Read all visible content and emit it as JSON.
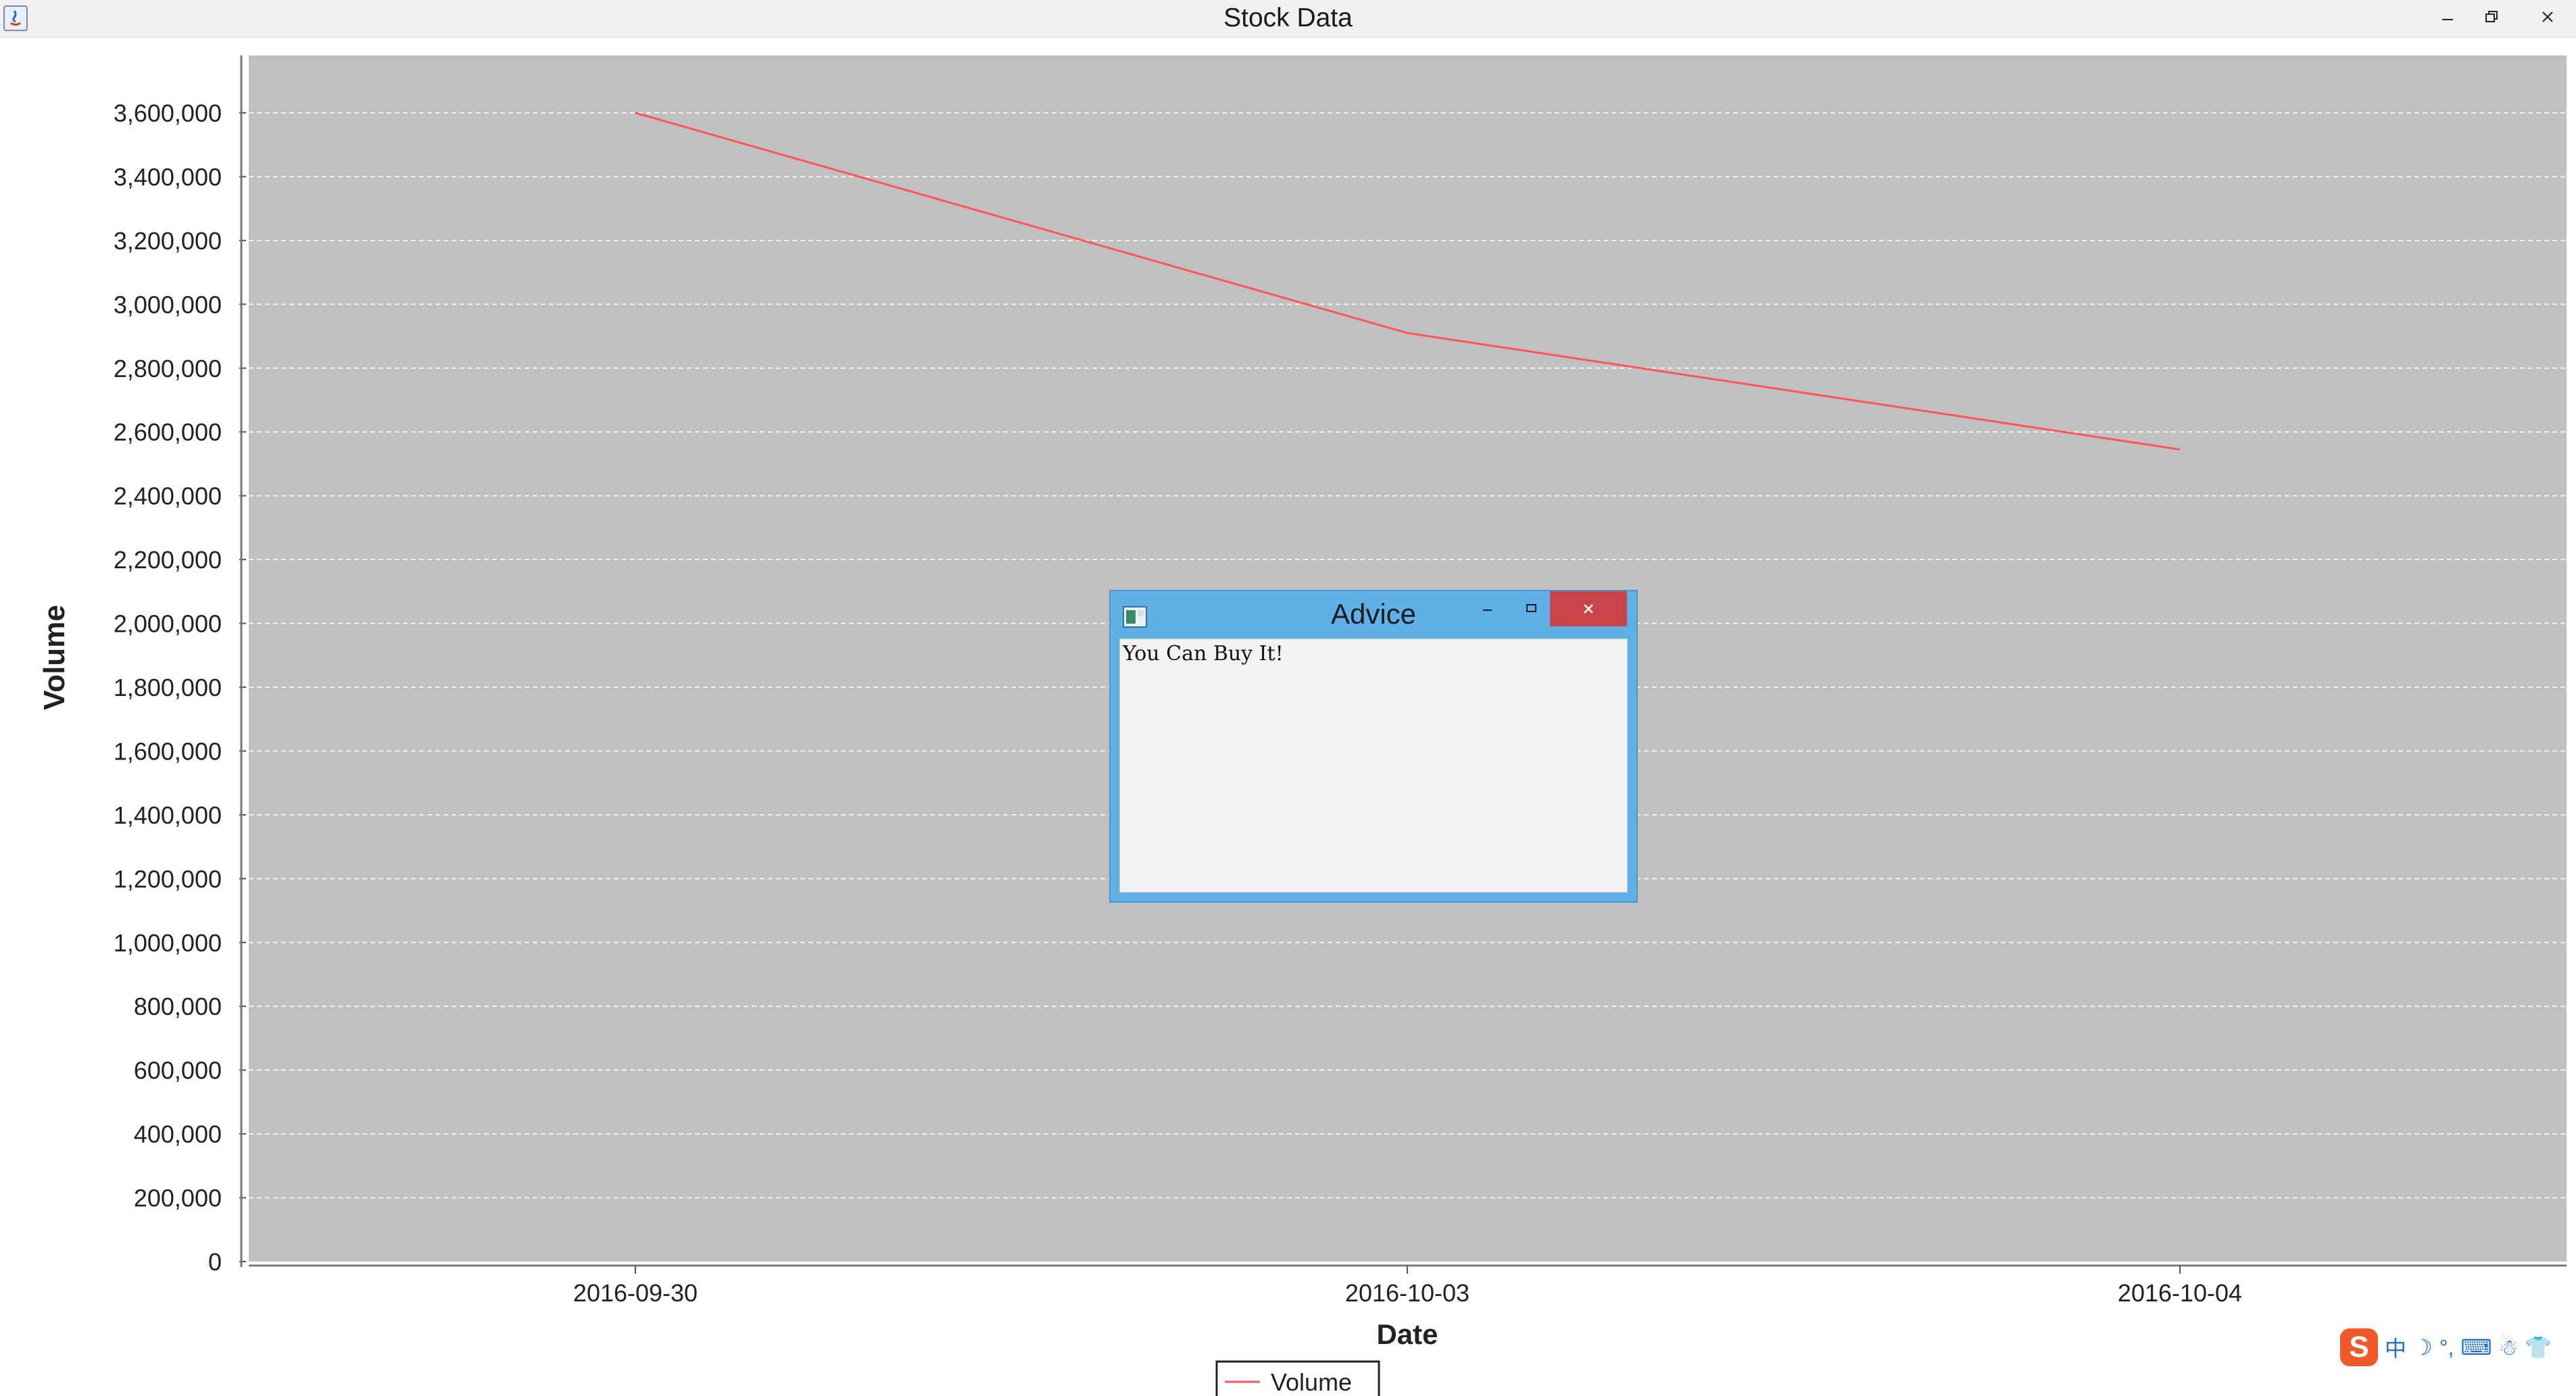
{
  "window": {
    "title": "Stock Data"
  },
  "dialog": {
    "title": "Advice",
    "message": "You Can Buy It!"
  },
  "ime": {
    "logo": "S",
    "glyphs": [
      "中",
      "☽",
      "°,",
      "⌨",
      "☃",
      "👕",
      "✓"
    ]
  },
  "chart_data": {
    "type": "line",
    "title": "",
    "xlabel": "Date",
    "ylabel": "Volume",
    "categories": [
      "2016-09-30",
      "2016-10-03",
      "2016-10-04"
    ],
    "series": [
      {
        "name": "Volume",
        "values": [
          3600000,
          2910000,
          2545000
        ],
        "color": "#ff5555"
      }
    ],
    "ylim": [
      0,
      3780000
    ],
    "yticks": [
      0,
      200000,
      400000,
      600000,
      800000,
      1000000,
      1200000,
      1400000,
      1600000,
      1800000,
      2000000,
      2200000,
      2400000,
      2600000,
      2800000,
      3000000,
      3200000,
      3400000,
      3600000
    ],
    "grid": true,
    "plot_background": "#c0c0c0",
    "legend": "bottom-center"
  }
}
